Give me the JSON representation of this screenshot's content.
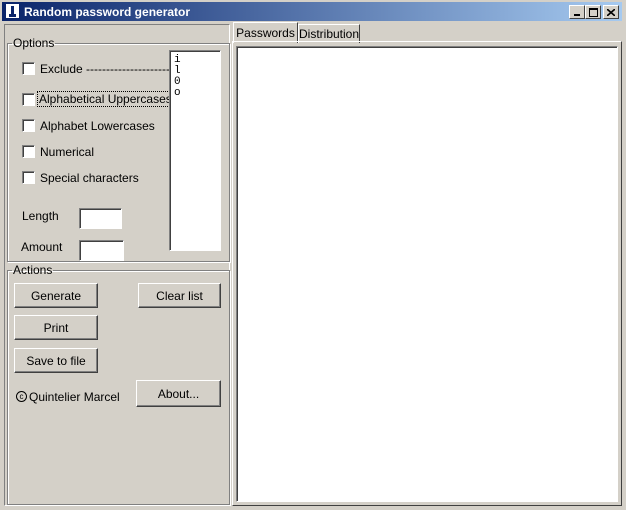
{
  "window": {
    "title": "Random password generator",
    "controls": {
      "minimize_icon": "minimize-icon",
      "maximize_icon": "maximize-icon",
      "close_icon": "close-icon"
    }
  },
  "options": {
    "legend": "Options",
    "checkboxes": [
      {
        "label": "Exclude ----------------------->",
        "checked": false
      },
      {
        "label": "Alphabetical Uppercases",
        "checked": false,
        "focused": true
      },
      {
        "label": "Alphabet Lowercases",
        "checked": false
      },
      {
        "label": "Numerical",
        "checked": false
      },
      {
        "label": "Special characters",
        "checked": false
      }
    ],
    "length_label": "Length",
    "length_value": "",
    "amount_label": "Amount",
    "amount_value": "",
    "exclude_list": [
      "i",
      "l",
      "0",
      "o"
    ]
  },
  "actions": {
    "legend": "Actions",
    "generate": "Generate",
    "clear_list": "Clear list",
    "print": "Print",
    "save_to_file": "Save to file",
    "about": "About...",
    "copyright": "Quintelier Marcel"
  },
  "tabs": [
    {
      "label": "Passwords",
      "active": true
    },
    {
      "label": "Distribution",
      "active": false
    }
  ],
  "colors": {
    "face": "#d4d0c8",
    "title_start": "#0a246a",
    "title_end": "#a6caf0"
  }
}
